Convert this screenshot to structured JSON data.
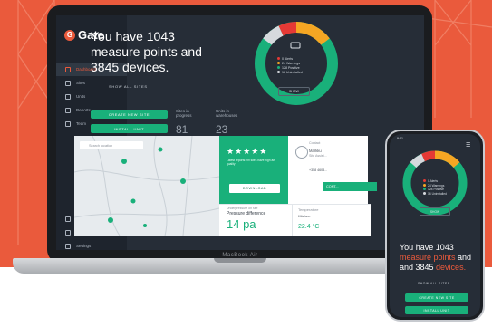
{
  "app": {
    "logo_mark": "G",
    "logo_text": "Gate"
  },
  "sidebar": {
    "items": [
      {
        "label": "Dashboard",
        "icon": "dashboard-icon",
        "active": true
      },
      {
        "label": "Sites",
        "icon": "sites-icon"
      },
      {
        "label": "Units",
        "icon": "units-icon"
      },
      {
        "label": "Reports",
        "icon": "reports-icon"
      },
      {
        "label": "Team",
        "icon": "team-icon"
      }
    ],
    "bottom": [
      {
        "label": "Notifications",
        "icon": "bell-icon"
      },
      {
        "label": "Willi's...",
        "icon": "user-icon"
      },
      {
        "label": "Settings",
        "icon": "gear-icon"
      }
    ]
  },
  "hero": {
    "headline_1": "You have 1043",
    "headline_2": "measure points and",
    "headline_3": "3845 devices.",
    "show_all": "SHOW ALL SITES",
    "create_site": "CREATE NEW SITE",
    "install_unit": "INSTALL UNIT",
    "in_progress_label": "Sites in progress",
    "in_progress_value": "81",
    "warehouses_label": "Units in warehouses",
    "warehouses_value": "23"
  },
  "status": {
    "legend": [
      {
        "count": "0",
        "label": "Alerts",
        "color": "#e53935"
      },
      {
        "count": "24",
        "label": "Warnings",
        "color": "#f5a623"
      },
      {
        "count": "128",
        "label": "Positive",
        "color": "#19b07a"
      },
      {
        "count": "16",
        "label": "Uninstalled",
        "color": "#d6d9dd"
      }
    ],
    "show_label": "SHOW",
    "ring_colors": {
      "green": "#19b07a",
      "orange": "#f5a623",
      "red": "#e53935",
      "grey": "#d6d9dd"
    }
  },
  "map": {
    "search_placeholder": "Search location"
  },
  "review": {
    "stars": "★★★★★",
    "text": "Latest reports: 99 sites have high air quality",
    "download": "DOWNLOAD"
  },
  "contact": {
    "label": "Contact",
    "name": "Markku",
    "role": "Site Assist...",
    "phone": "+358 4603...",
    "button": "CONT..."
  },
  "pressure": {
    "caption": "Underpressure on site",
    "title": "Pressure difference",
    "value": "14 pa"
  },
  "temperature": {
    "caption": "Temperature",
    "title": "Kitchen",
    "value": "22.4 °C"
  },
  "laptop": {
    "model": "MacBook Air"
  },
  "phone": {
    "time": "9:41",
    "legend": [
      {
        "count": "0",
        "label": "Alerts",
        "color": "#e53935"
      },
      {
        "count": "24",
        "label": "Warnings",
        "color": "#f5a623"
      },
      {
        "count": "128",
        "label": "Positive",
        "color": "#19b07a"
      },
      {
        "count": "16",
        "label": "Uninstalled",
        "color": "#d6d9dd"
      }
    ],
    "show_label": "SHOW",
    "headline_1": "You have 1043",
    "headline_2a": "measure points",
    "headline_2b": " and",
    "headline_3a": "and 3845 ",
    "headline_3b": "devices.",
    "show_all": "SHOW ALL SITES",
    "create_site": "CREATE NEW SITE",
    "install_unit": "INSTALL UNIT"
  }
}
